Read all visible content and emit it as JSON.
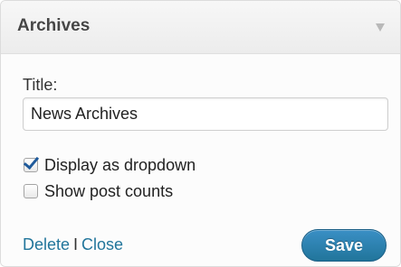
{
  "widget": {
    "title": "Archives",
    "toggle_icon": "collapse-arrow-icon"
  },
  "form": {
    "title_label": "Title:",
    "title_value": "News Archives",
    "options": [
      {
        "label": "Display as dropdown",
        "checked": true
      },
      {
        "label": "Show post counts",
        "checked": false
      }
    ]
  },
  "footer": {
    "delete_label": "Delete",
    "separator": "I",
    "close_label": "Close",
    "save_label": "Save"
  },
  "colors": {
    "link": "#21759b",
    "save_button": "#21759b",
    "checkmark": "#1f5a9b"
  }
}
